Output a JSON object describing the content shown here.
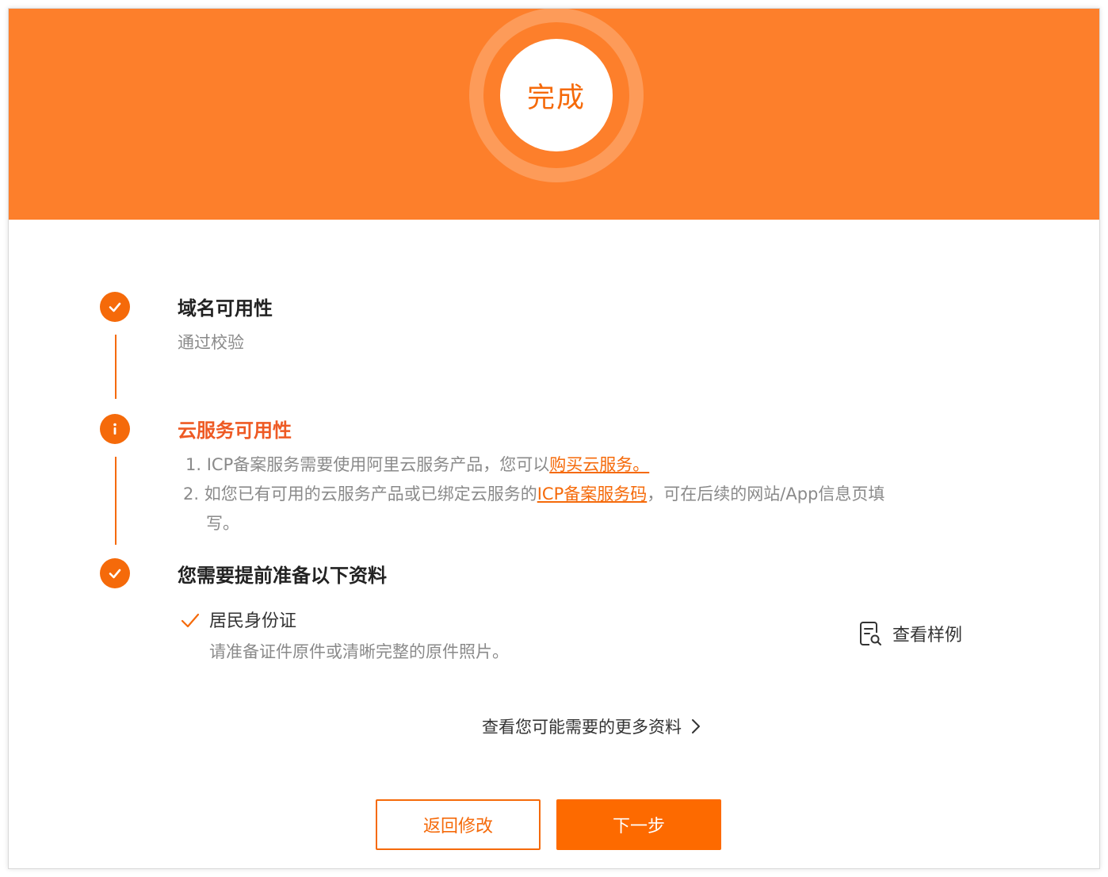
{
  "banner": {
    "status_label": "完成"
  },
  "steps": [
    {
      "title": "域名可用性",
      "subtitle": "通过校验",
      "icon": "check-icon"
    },
    {
      "title": "云服务可用性",
      "icon": "info-icon"
    },
    {
      "title": "您需要提前准备以下资料",
      "icon": "check-icon"
    }
  ],
  "cloud_notes": {
    "line1_prefix": "1. ICP备案服务需要使用阿里云服务产品，您可以",
    "line1_link": "购买云服务。",
    "line2_prefix": "2. 如您已有可用的云服务产品或已绑定云服务的",
    "line2_link": "ICP备案服务码",
    "line2_suffix": "，可在后续的网站/App信息页填",
    "line2_wrap": "写。"
  },
  "documents": [
    {
      "name": "居民身份证",
      "description": "请准备证件原件或清晰完整的原件照片。"
    }
  ],
  "sample_link": "查看样例",
  "more_link": "查看您可能需要的更多资料",
  "buttons": {
    "back": "返回修改",
    "next": "下一步"
  },
  "colors": {
    "brand_orange": "#fd7f2b",
    "accent": "#f56a0a",
    "warning_title": "#ee5a24"
  }
}
